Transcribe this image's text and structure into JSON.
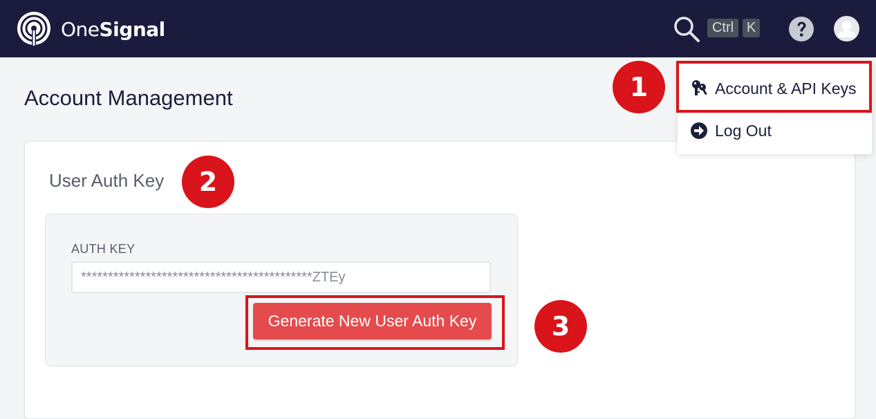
{
  "header": {
    "brand_part1": "One",
    "brand_part2": "Signal",
    "shortcut_keys": [
      "Ctrl",
      "K"
    ]
  },
  "page": {
    "title": "Account Management"
  },
  "auth_section": {
    "title": "User Auth Key",
    "field_label": "AUTH KEY",
    "field_value": "*******************************************ZTEy",
    "generate_button_label": "Generate New User Auth Key"
  },
  "user_menu": {
    "items": [
      {
        "label": "Account & API Keys",
        "icon": "key-icon"
      },
      {
        "label": "Log Out",
        "icon": "logout-icon"
      }
    ]
  },
  "annotations": {
    "step1": "1",
    "step2": "2",
    "step3": "3"
  },
  "colors": {
    "topbar": "#1b1c3d",
    "accent_button": "#e54b4d",
    "annotation_red": "#d9141b"
  }
}
